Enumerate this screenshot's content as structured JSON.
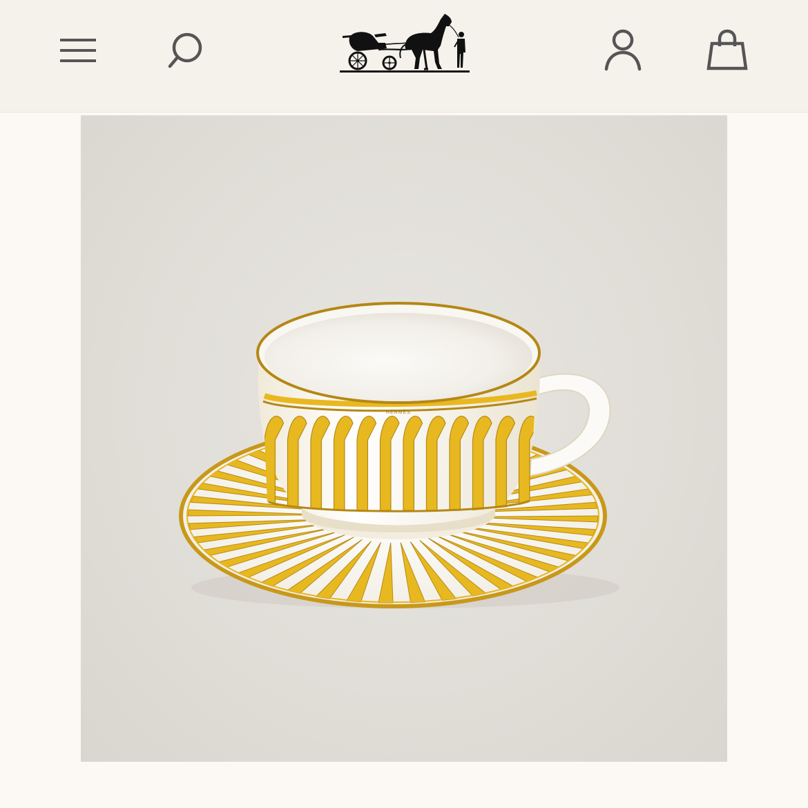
{
  "header": {
    "menu_icon": "hamburger-menu-icon",
    "search_icon": "search-icon",
    "logo": "brand-logo",
    "account_icon": "account-icon",
    "cart_icon": "shopping-bag-icon"
  },
  "product": {
    "image": "teacup-and-saucer-photo",
    "cup_brand_text": "HERMÈS"
  },
  "colors": {
    "header_bg": "#f5f2ec",
    "page_bg": "#fcf9f4",
    "image_bg": "#e3e0da",
    "accent_yellow": "#e8b820",
    "gold": "#b58a17"
  }
}
